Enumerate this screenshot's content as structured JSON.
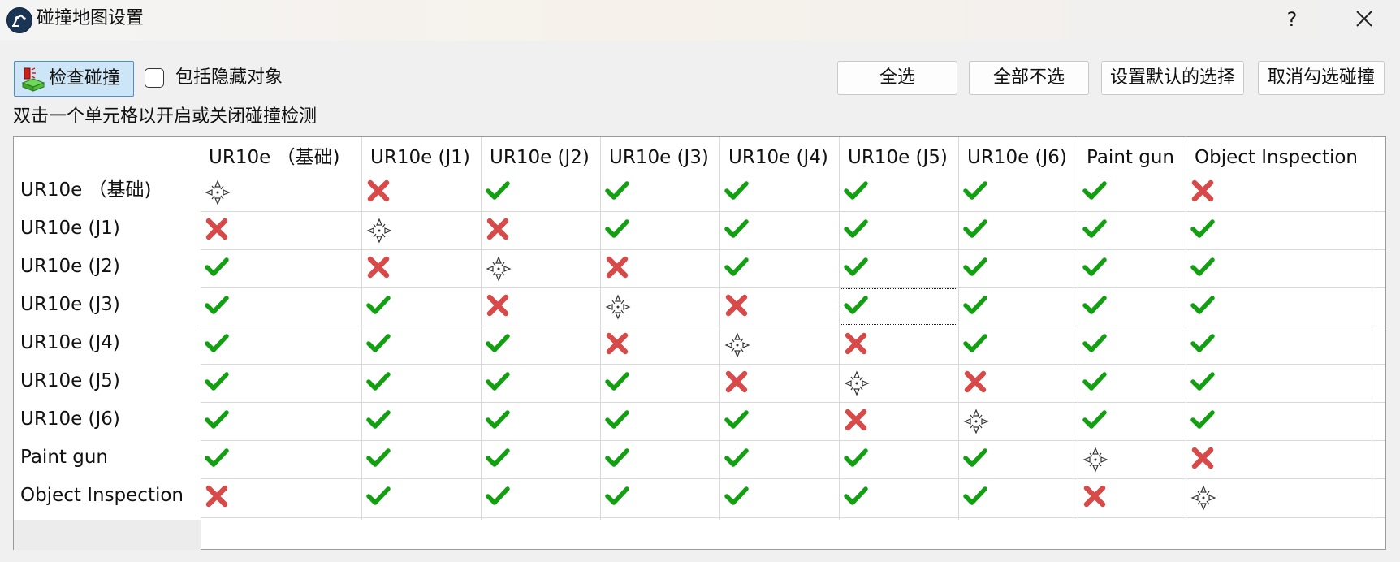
{
  "window": {
    "title": "碰撞地图设置",
    "help_label": "?"
  },
  "toolbar": {
    "check_collision_label": "检查碰撞",
    "include_hidden_label": "包括隐藏对象",
    "include_hidden_checked": false,
    "select_all_label": "全选",
    "select_none_label": "全部不选",
    "set_default_label": "设置默认的选择",
    "uncheck_collisions_label": "取消勾选碰撞"
  },
  "hint_text": "双击一个单元格以开启或关闭碰撞检测",
  "colors": {
    "check": "#12a012",
    "cross": "#d84a4a",
    "accent": "#4a8fcf"
  },
  "matrix": {
    "columns": [
      "UR10e （基础)",
      "UR10e (J1)",
      "UR10e (J2)",
      "UR10e (J3)",
      "UR10e (J4)",
      "UR10e (J5)",
      "UR10e (J6)",
      "Paint gun",
      "Object Inspection"
    ],
    "rows": [
      {
        "label": "UR10e （基础)",
        "cells": [
          "self",
          "off",
          "on",
          "on",
          "on",
          "on",
          "on",
          "on",
          "off"
        ]
      },
      {
        "label": "UR10e (J1)",
        "cells": [
          "off",
          "self",
          "off",
          "on",
          "on",
          "on",
          "on",
          "on",
          "on"
        ]
      },
      {
        "label": "UR10e (J2)",
        "cells": [
          "on",
          "off",
          "self",
          "off",
          "on",
          "on",
          "on",
          "on",
          "on"
        ]
      },
      {
        "label": "UR10e (J3)",
        "cells": [
          "on",
          "on",
          "off",
          "self",
          "off",
          "on",
          "on",
          "on",
          "on"
        ]
      },
      {
        "label": "UR10e (J4)",
        "cells": [
          "on",
          "on",
          "on",
          "off",
          "self",
          "off",
          "on",
          "on",
          "on"
        ]
      },
      {
        "label": "UR10e (J5)",
        "cells": [
          "on",
          "on",
          "on",
          "on",
          "off",
          "self",
          "off",
          "on",
          "on"
        ]
      },
      {
        "label": "UR10e (J6)",
        "cells": [
          "on",
          "on",
          "on",
          "on",
          "on",
          "off",
          "self",
          "on",
          "on"
        ]
      },
      {
        "label": "Paint gun",
        "cells": [
          "on",
          "on",
          "on",
          "on",
          "on",
          "on",
          "on",
          "self",
          "off"
        ]
      },
      {
        "label": "Object Inspection",
        "cells": [
          "off",
          "on",
          "on",
          "on",
          "on",
          "on",
          "on",
          "off",
          "self"
        ]
      }
    ],
    "focused_cell": {
      "row": 3,
      "col": 5
    }
  }
}
